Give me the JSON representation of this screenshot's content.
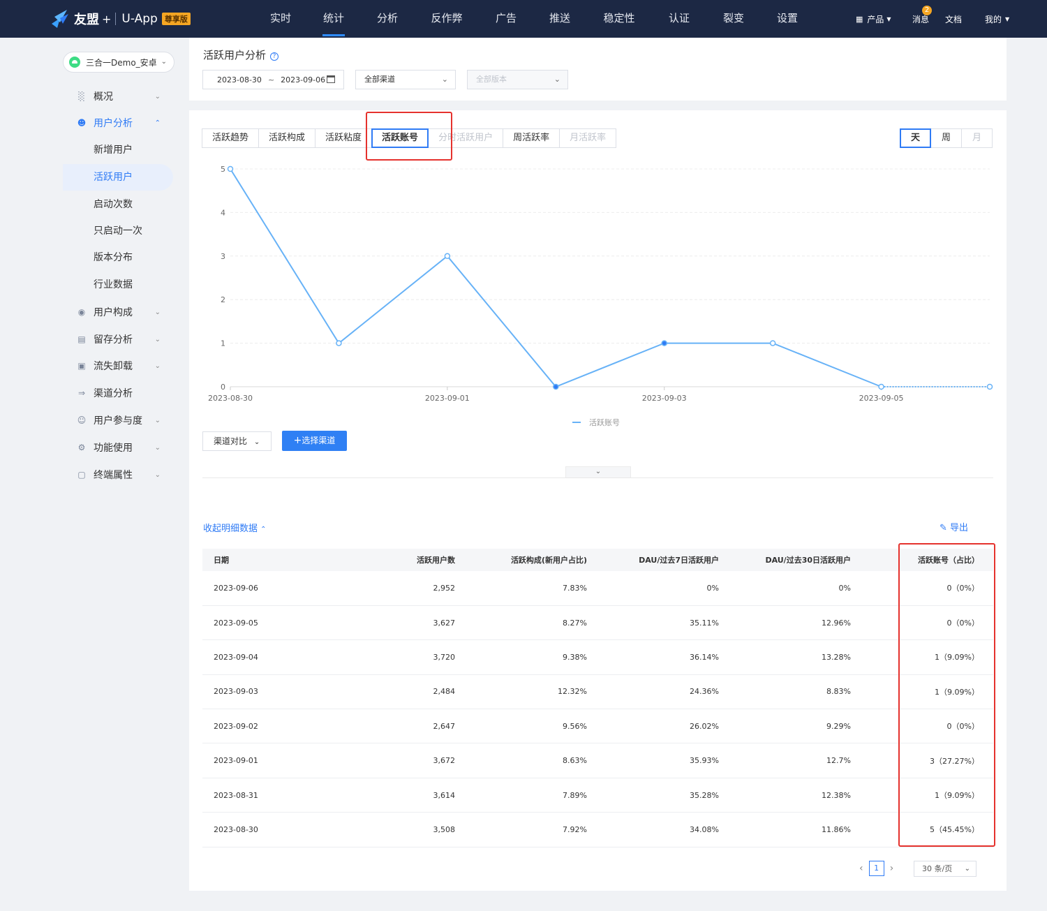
{
  "topnav": {
    "brand": "友盟",
    "plus": "+",
    "app_name": "U-App",
    "edition_badge": "尊享版",
    "menu": [
      "实时",
      "统计",
      "分析",
      "反作弊",
      "广告",
      "推送",
      "稳定性",
      "认证",
      "裂变",
      "设置"
    ],
    "active_menu": "统计",
    "products": "产品",
    "messages": "消息",
    "message_count": "2",
    "docs": "文档",
    "mine": "我的"
  },
  "sidebar": {
    "app_selector": "三合一Demo_安卓",
    "items": [
      {
        "label": "概况",
        "icon": "overview-chart-icon"
      },
      {
        "label": "用户分析",
        "icon": "user-analysis-icon"
      },
      {
        "label": "新增用户"
      },
      {
        "label": "活跃用户"
      },
      {
        "label": "启动次数"
      },
      {
        "label": "只启动一次"
      },
      {
        "label": "版本分布"
      },
      {
        "label": "行业数据"
      },
      {
        "label": "用户构成",
        "icon": "user-composition-icon"
      },
      {
        "label": "留存分析",
        "icon": "retention-icon"
      },
      {
        "label": "流失卸载",
        "icon": "churn-icon"
      },
      {
        "label": "渠道分析",
        "icon": "channel-icon"
      },
      {
        "label": "用户参与度",
        "icon": "engagement-icon"
      },
      {
        "label": "功能使用",
        "icon": "feature-icon"
      },
      {
        "label": "终端属性",
        "icon": "device-icon"
      }
    ]
  },
  "header": {
    "title": "活跃用户分析",
    "date_start": "2023-08-30",
    "date_sep": "~",
    "date_end": "2023-09-06",
    "channel_select": "全部渠道",
    "version_select": "全部版本"
  },
  "tabs": [
    "活跃趋势",
    "活跃构成",
    "活跃粘度",
    "活跃账号",
    "分时活跃用户",
    "周活跃率",
    "月活跃率"
  ],
  "active_tab": "活跃账号",
  "period": [
    "天",
    "周",
    "月"
  ],
  "active_period": "天",
  "chart_data": {
    "type": "line",
    "x": [
      "2023-08-30",
      "2023-08-31",
      "2023-09-01",
      "2023-09-02",
      "2023-09-03",
      "2023-09-04",
      "2023-09-05",
      "2023-09-06"
    ],
    "xticks": [
      "2023-08-30",
      "2023-09-01",
      "2023-09-03",
      "2023-09-05"
    ],
    "series": [
      {
        "name": "活跃账号",
        "values": [
          5,
          1,
          3,
          0,
          1,
          1,
          0,
          0
        ],
        "color": "#67b2f7"
      }
    ],
    "ylim": [
      0,
      5
    ],
    "yticks": [
      0,
      1,
      2,
      3,
      4,
      5
    ],
    "legend": "bottom",
    "grid": true
  },
  "controls": {
    "compare": "渠道对比",
    "add_channel": "选择渠道"
  },
  "detail": {
    "collapse_link": "收起明细数据",
    "export": "导出",
    "columns": [
      "日期",
      "活跃用户数",
      "活跃构成(新用户占比)",
      "DAU/过去7日活跃用户",
      "DAU/过去30日活跃用户",
      "活跃账号（占比）"
    ],
    "rows": [
      [
        "2023-09-06",
        "2,952",
        "7.83%",
        "0%",
        "0%",
        "0（0%）"
      ],
      [
        "2023-09-05",
        "3,627",
        "8.27%",
        "35.11%",
        "12.96%",
        "0（0%）"
      ],
      [
        "2023-09-04",
        "3,720",
        "9.38%",
        "36.14%",
        "13.28%",
        "1（9.09%）"
      ],
      [
        "2023-09-03",
        "2,484",
        "12.32%",
        "24.36%",
        "8.83%",
        "1（9.09%）"
      ],
      [
        "2023-09-02",
        "2,647",
        "9.56%",
        "26.02%",
        "9.29%",
        "0（0%）"
      ],
      [
        "2023-09-01",
        "3,672",
        "8.63%",
        "35.93%",
        "12.7%",
        "3（27.27%）"
      ],
      [
        "2023-08-31",
        "3,614",
        "7.89%",
        "35.28%",
        "12.38%",
        "1（9.09%）"
      ],
      [
        "2023-08-30",
        "3,508",
        "7.92%",
        "34.08%",
        "11.86%",
        "5（45.45%）"
      ]
    ]
  },
  "pagination": {
    "current_page": "1",
    "page_size": "30 条/页"
  },
  "colors": {
    "accent": "#2f7bf5",
    "nav_bg": "#1c2844",
    "highlight": "#e5322d",
    "line": "#67b2f7"
  }
}
